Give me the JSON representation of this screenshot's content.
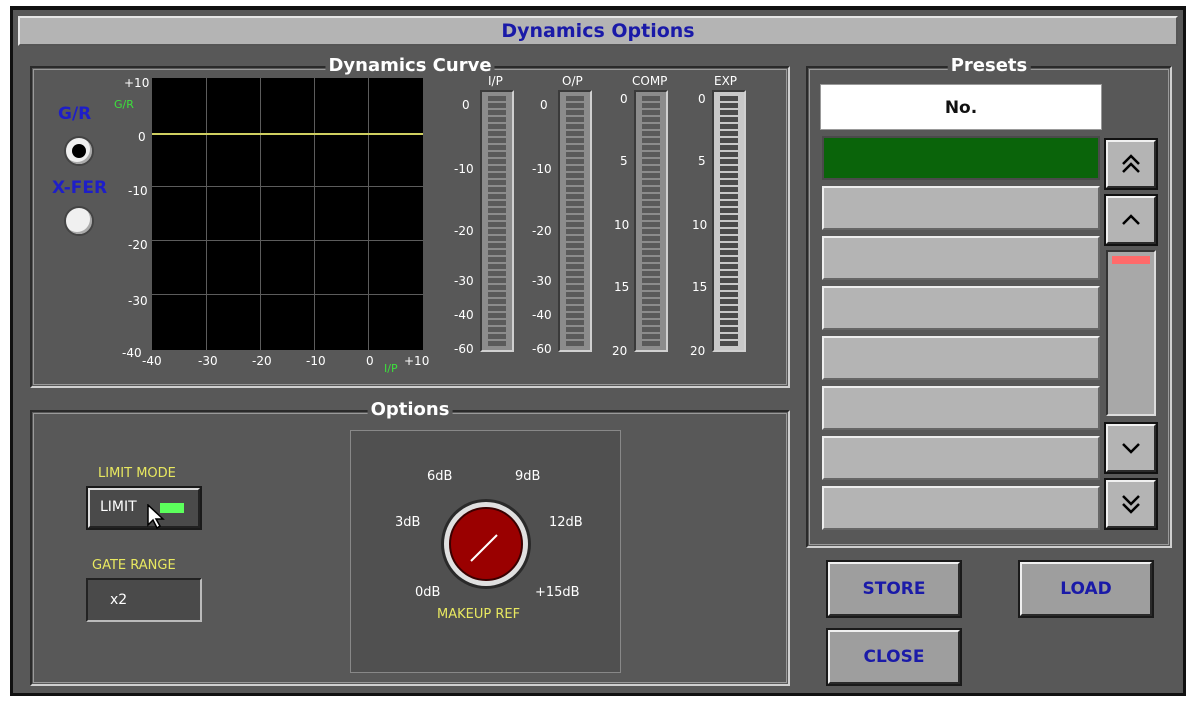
{
  "window": {
    "title": "Dynamics Options"
  },
  "curve": {
    "title": "Dynamics Curve",
    "gr_label": "G/R",
    "xfer_label": "X-FER",
    "gr_axis": "G/R",
    "ip_axis": "I/P",
    "y_ticks": [
      "+10",
      "0",
      "-10",
      "-20",
      "-30",
      "-40"
    ],
    "x_ticks": [
      "-40",
      "-30",
      "-20",
      "-10",
      "0",
      "+10"
    ],
    "selected_mode": "G/R"
  },
  "meters": [
    {
      "label": "I/P",
      "ticks": [
        "0",
        "-10",
        "-20",
        "-30",
        "-40",
        "-60"
      ]
    },
    {
      "label": "O/P",
      "ticks": [
        "0",
        "-10",
        "-20",
        "-30",
        "-40",
        "-60"
      ]
    },
    {
      "label": "COMP",
      "ticks": [
        "0",
        "5",
        "10",
        "15",
        "20"
      ]
    },
    {
      "label": "EXP",
      "ticks": [
        "0",
        "5",
        "10",
        "15",
        "20"
      ]
    }
  ],
  "options": {
    "title": "Options",
    "limit_mode_label": "LIMIT MODE",
    "limit_button": "LIMIT",
    "gate_range_label": "GATE RANGE",
    "gate_range_value": "x2",
    "knob_label": "MAKEUP REF",
    "knob_scale": [
      "0dB",
      "3dB",
      "6dB",
      "9dB",
      "12dB",
      "+15dB"
    ]
  },
  "presets": {
    "title": "Presets",
    "column_header": "No.",
    "rows": [
      "",
      "",
      "",
      "",
      "",
      "",
      "",
      ""
    ],
    "selected_index": 0
  },
  "buttons": {
    "store": "STORE",
    "load": "LOAD",
    "close": "CLOSE"
  },
  "colors": {
    "window_bg": "#585858",
    "title_text": "#1a1aa8",
    "selected_row": "#0a640a",
    "led": "#5cff5c",
    "knob": "#9a0000"
  }
}
